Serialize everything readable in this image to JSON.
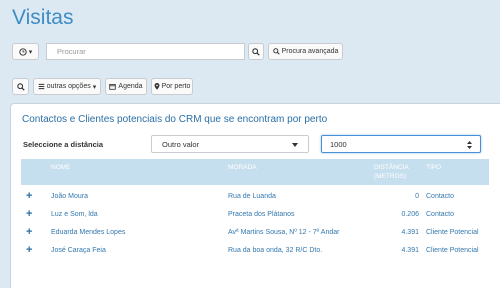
{
  "page": {
    "title": "Visitas"
  },
  "toolbar": {
    "clock_caret": "▾",
    "search_placeholder": "Procurar",
    "advanced_search_label": "Procura avançada",
    "more_options_label": "outras opções",
    "agenda_label": "Agenda",
    "nearby_label": "Por perto"
  },
  "panel": {
    "title": "Contactos e Clientes potenciais do CRM que se encontram por perto",
    "distance_label": "Seleccione a distância",
    "distance_select_value": "Outro valor",
    "distance_input_value": "1000"
  },
  "table": {
    "headers": {
      "name": "NOME",
      "address": "MORADA",
      "distance": "DISTÂNCIA",
      "distance_unit": "(METROS)",
      "type": "TIPO"
    },
    "rows": [
      {
        "name": "João Moura",
        "address": "Rua de Luanda",
        "distance": "0",
        "type": "Contacto"
      },
      {
        "name": "Luz e Som, lda",
        "address": "Praceta dos Plátanos",
        "distance": "0.206",
        "type": "Contacto"
      },
      {
        "name": "Eduarda Mendes Lopes",
        "address": "Avª Martins Sousa, Nº 12 - 7º Andar",
        "distance": "4.391",
        "type": "Cliente Potencial"
      },
      {
        "name": "José Caraça Feia",
        "address": "Rua da boa onda, 32 R/C Dto.",
        "distance": "4.391",
        "type": "Cliente Potencial"
      }
    ]
  }
}
